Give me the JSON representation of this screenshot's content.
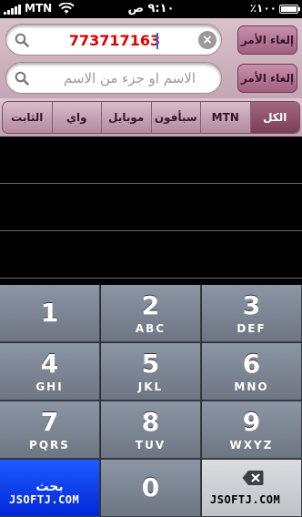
{
  "status_bar": {
    "carrier": "MTN",
    "time": "٩:١٠ ص",
    "battery_percent": "٪١٠٠"
  },
  "search": {
    "number_value": "773717163",
    "name_placeholder": "الاسم او جزء من الاسم",
    "cancel_label": "إلغاء الأمر",
    "cancel_label_2": "إلغاء الأمر"
  },
  "tabs": [
    {
      "label": "الثابت"
    },
    {
      "label": "واي"
    },
    {
      "label": "موبايل"
    },
    {
      "label": "سبأفون"
    },
    {
      "label": "MTN"
    },
    {
      "label": "الكل"
    }
  ],
  "keypad": {
    "keys": [
      {
        "num": "1",
        "letters": ""
      },
      {
        "num": "2",
        "letters": "ABC"
      },
      {
        "num": "3",
        "letters": "DEF"
      },
      {
        "num": "4",
        "letters": "GHI"
      },
      {
        "num": "5",
        "letters": "JKL"
      },
      {
        "num": "6",
        "letters": "MNO"
      },
      {
        "num": "7",
        "letters": "PQRS"
      },
      {
        "num": "8",
        "letters": "TUV"
      },
      {
        "num": "9",
        "letters": "WXYZ"
      },
      {
        "num": "0",
        "letters": ""
      }
    ],
    "search_label": "بحث"
  },
  "watermark": "JSOFTJ.COM",
  "colors": {
    "accent": "#a0607e",
    "search_key": "#0026d8",
    "number_text": "#dd0000"
  }
}
